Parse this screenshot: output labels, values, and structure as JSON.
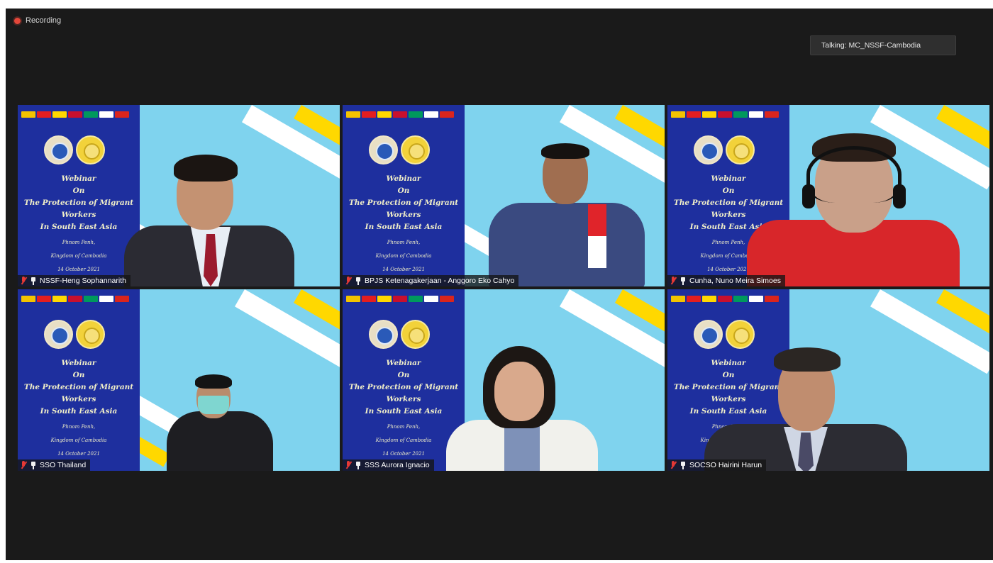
{
  "recording": {
    "label": "Recording"
  },
  "talking": {
    "text": "Talking: MC_NSSF-Cambodia"
  },
  "banner": {
    "lines": [
      "Webinar",
      "On",
      "The Protection of Migrant",
      "Workers",
      "In South East Asia"
    ],
    "place": "Phnom Penh,",
    "country": "Kingdom of Cambodia",
    "date": "14 October 2021"
  },
  "participants": [
    {
      "name": "NSSF-Heng Sophannarith"
    },
    {
      "name": "BPJS Ketenagakerjaan - Anggoro Eko Cahyo"
    },
    {
      "name": "Cunha, Nuno Meira Simoes"
    },
    {
      "name": "SSO Thailand"
    },
    {
      "name": "SSS Aurora Ignacio"
    },
    {
      "name": "SOCSO Hairini Harun"
    }
  ],
  "colors": {
    "stage": "#1a1a1a",
    "banner": "#1e2f9e",
    "sky": "#7fd3ee",
    "accent_yellow": "#ffd800",
    "mic_muted": "#e53935"
  }
}
